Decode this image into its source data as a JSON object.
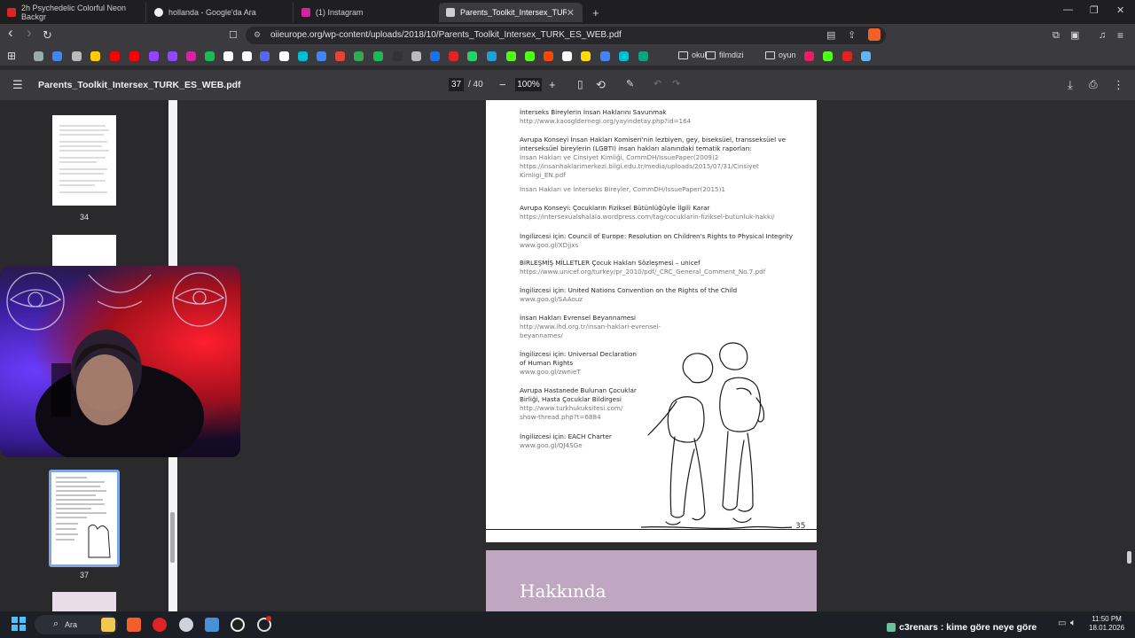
{
  "tabs": [
    {
      "title": "2h Psychedelic Colorful Neon Backgr",
      "favicon_color": "#e02424",
      "active": false
    },
    {
      "title": "hollanda - Google'da Ara",
      "favicon_color": "#f1f1f1",
      "active": false
    },
    {
      "title": "(1) Instagram",
      "favicon_color": "#d6249f",
      "active": false
    },
    {
      "title": "Parents_Toolkit_Intersex_TURK_E",
      "favicon_color": "#cfcfcf",
      "active": true
    }
  ],
  "new_tab_label": "+",
  "window": {
    "minimize": "—",
    "restore": "❐",
    "close": "✕"
  },
  "nav": {
    "url": "oiieurope.org/wp-content/uploads/2018/10/Parents_Toolkit_Intersex_TURK_ES_WEB.pdf",
    "back": "‹",
    "forward": "›",
    "reload": "↻"
  },
  "bookmarks": {
    "folders": [
      "okul",
      "filmdizi",
      "oyun"
    ],
    "icon_colors": [
      "#9aa",
      "#4285f4",
      "#bbb",
      "#ffcc00",
      "#ff0000",
      "#ff0000",
      "#9146ff",
      "#9146ff",
      "#d6249f",
      "#1db954",
      "#ffffff",
      "#ffffff",
      "#5865f2",
      "#ffffff",
      "#00bcd4",
      "#4285f4",
      "#ea4335",
      "#34a853",
      "#1db954",
      "#333",
      "#bbb",
      "#1a73e8",
      "#e02424",
      "#25d366",
      "#229ed9",
      "#53fc18",
      "#53fc18",
      "#ff4500",
      "#ffffff",
      "#ffdd00",
      "#4285f4",
      "#00bcd4",
      "#10a37f"
    ],
    "trailing_icon_colors": [
      "#e91e63",
      "#53fc18",
      "#e02424",
      "#64b5f6"
    ]
  },
  "pdf": {
    "filename": "Parents_Toolkit_Intersex_TURK_ES_WEB.pdf",
    "page_current": "37",
    "page_total": "/ 40",
    "zoom": "100%",
    "zoom_out": "−",
    "zoom_in": "+"
  },
  "sidebar": {
    "thumbnails": [
      {
        "label": "34"
      },
      {
        "label": "37"
      }
    ]
  },
  "page": {
    "entries": [
      {
        "heading": "İnterseks Bireylerin İnsan Haklarını Savunmak",
        "lines": [
          "http://www.kaosgldernegi.org/yayindetay.php?id=164"
        ]
      },
      {
        "heading": "Avrupa Konseyi İnsan Hakları Komiseri'nin lezbiyen, gey, biseksüel, transseksüel ve interseksüel bireylerin (LGBTI) insan hakları alanındaki tematik raporları:",
        "lines": [
          "İnsan Hakları ve Cinsiyet Kimliği, CommDH/IssuePaper(2009)2",
          "https://insanhaklarimerkezi.bilgi.edu.tr/media/uploads/2015/07/31/Cinsiyet Kimligi_EN.pdf"
        ]
      },
      {
        "heading": "",
        "lines": [
          "İnsan Hakları ve İnterseks Bireyler, CommDH/IssuePaper(2015)1"
        ]
      },
      {
        "heading": "Avrupa Konseyi: Çocukların Fiziksel Bütünlüğüyle İlgili Karar",
        "lines": [
          "https://intersexualshalala.wordpress.com/tag/cocuklarin-fiziksel-butunluk-hakki/"
        ]
      },
      {
        "heading": "İngilizcesi için: Council of Europe: Resolution on Children's Rights to Physical Integrity",
        "lines": [
          "www.goo.gl/XDjjxs"
        ]
      },
      {
        "heading": "BİRLEŞMİŞ MİLLETLER Çocuk Hakları Sözleşmesi – unicef",
        "lines": [
          "https://www.unicef.org/turkey/pr_2010/pdf/_CRC_General_Comment_No.7.pdf"
        ]
      },
      {
        "heading": "İngilizcesi için: United Nations Convention on the Rights of the Child",
        "lines": [
          "www.goo.gl/SAAouz"
        ]
      },
      {
        "heading": "İnsan Hakları Evrensel Beyannamesi",
        "lines": [
          "http://www.ihd.org.tr/insan-haklari-evrensel-",
          "beyannames/"
        ]
      },
      {
        "heading": "İngilizcesi için: Universal Declaration of Human Rights",
        "lines": [
          "www.goo.gl/zwnieT"
        ]
      },
      {
        "heading": "Avrupa Hastanede Bulunan Çocuklar Birliği, Hasta Çocuklar Bildirgesi",
        "lines": [
          "http://www.turkhukuksitesi.com/",
          "show-thread.php?t=6884"
        ]
      },
      {
        "heading": "İngilizcesi için: EACH Charter",
        "lines": [
          "www.goo.gl/QJ4SGe"
        ]
      }
    ],
    "page_number": "35",
    "next_page_heading": "Hakkında"
  },
  "taskbar": {
    "search_label": "Ara",
    "stream_text": "c3renars : kime göre neye göre",
    "time": "11:50 PM",
    "date": "18.01.2026"
  }
}
